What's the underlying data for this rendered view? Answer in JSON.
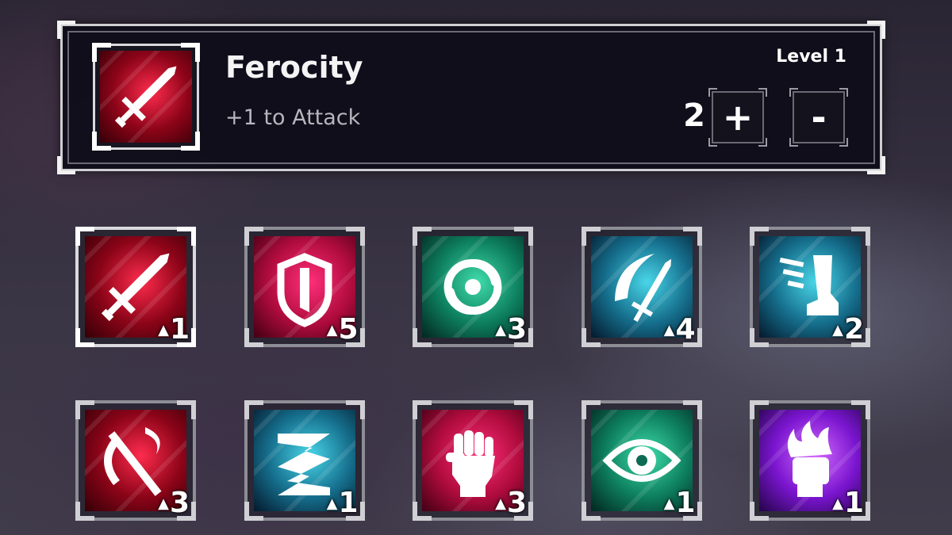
{
  "selected_skill": {
    "name": "Ferocity",
    "description": "+1 to Attack",
    "level_label": "Level 1",
    "points": "2",
    "plus_label": "+",
    "minus_label": "-",
    "icon": "sword-icon"
  },
  "colors": {
    "red": "#c4102f",
    "crimson": "#c8144f",
    "green": "#0f8a6c",
    "teal": "#1b7f9a",
    "purple": "#7b1fd0",
    "frame": "#8d8d95",
    "frame_selected": "#dadade"
  },
  "skills": [
    {
      "name": "sword",
      "icon": "sword-icon",
      "rank": "1",
      "theme": "red",
      "selected": true
    },
    {
      "name": "shield",
      "icon": "shield-icon",
      "rank": "5",
      "theme": "crimson"
    },
    {
      "name": "whirlwind",
      "icon": "whirlwind-icon",
      "rank": "3",
      "theme": "green"
    },
    {
      "name": "slash",
      "icon": "sword-slash-icon",
      "rank": "4",
      "theme": "teal"
    },
    {
      "name": "dash",
      "icon": "boot-speed-icon",
      "rank": "2",
      "theme": "teal"
    },
    {
      "name": "broken-axe",
      "icon": "broken-axe-icon",
      "rank": "3",
      "theme": "red"
    },
    {
      "name": "zigzag",
      "icon": "zigzag-ribbon-icon",
      "rank": "1",
      "theme": "teal"
    },
    {
      "name": "fist",
      "icon": "fist-icon",
      "rank": "3",
      "theme": "crimson"
    },
    {
      "name": "eye",
      "icon": "eye-icon",
      "rank": "1",
      "theme": "green"
    },
    {
      "name": "flame-fist",
      "icon": "flaming-fist-icon",
      "rank": "1",
      "theme": "purple"
    }
  ]
}
